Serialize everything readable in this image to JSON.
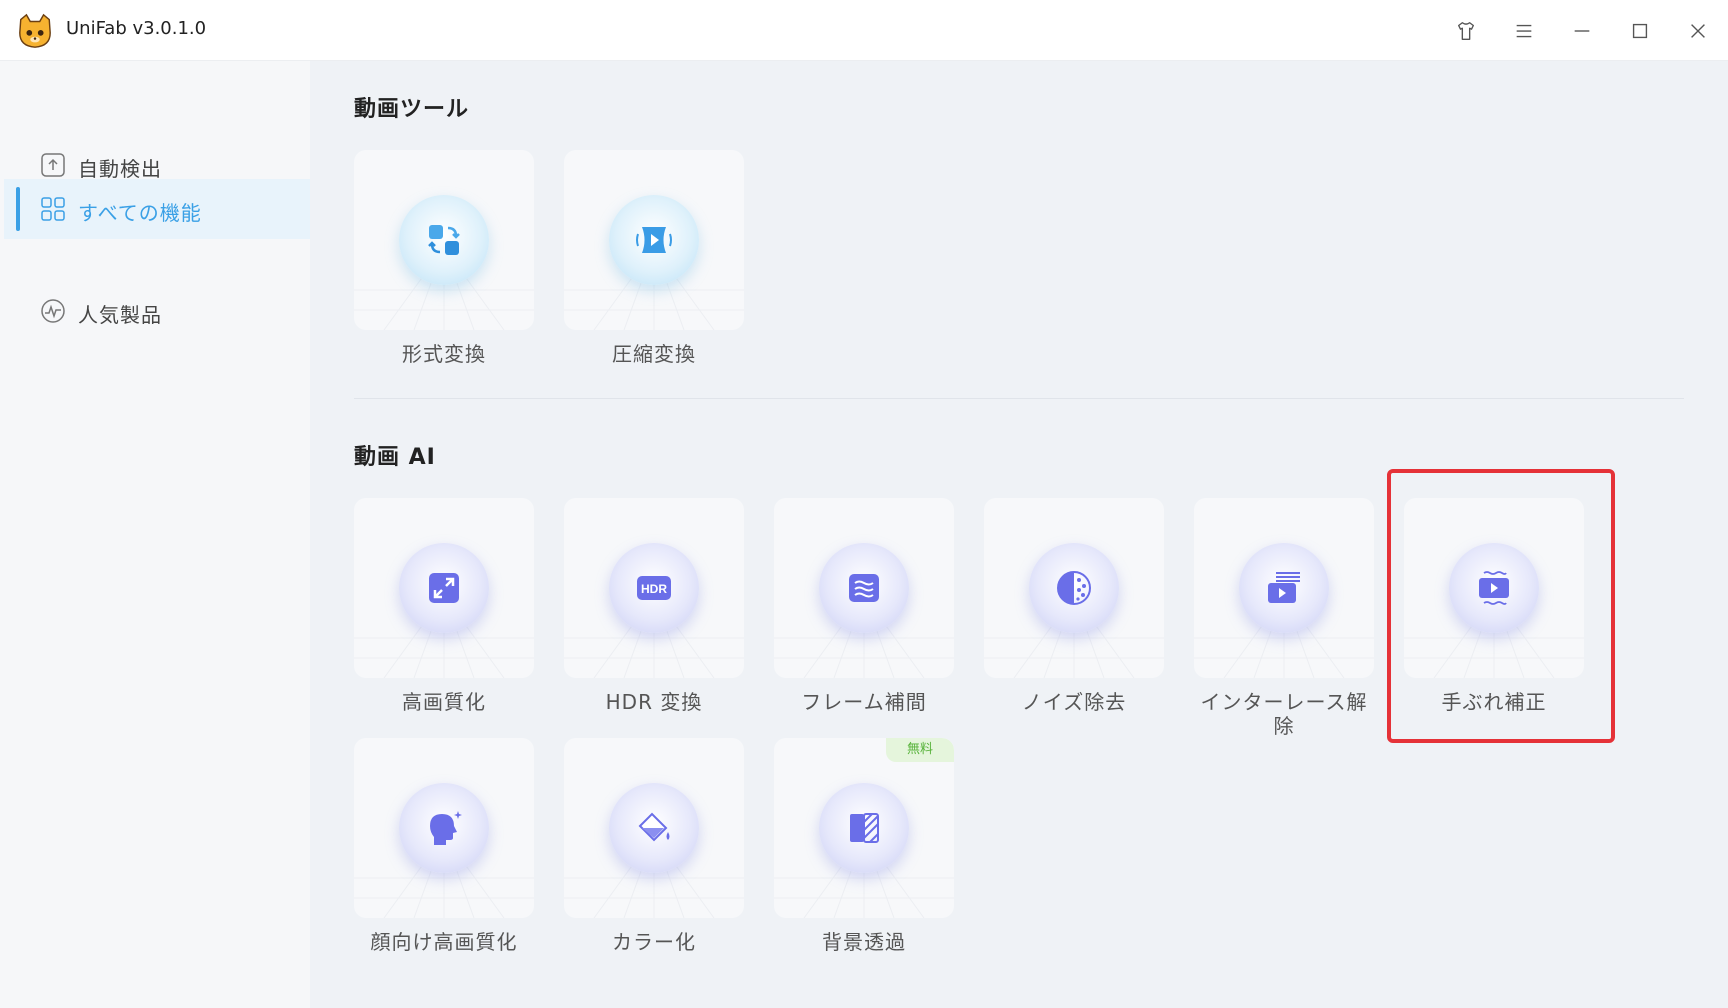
{
  "app": {
    "title": "UniFab v3.0.1.0"
  },
  "titlebar": {
    "icons": [
      "shirt-icon",
      "menu-icon",
      "minimize-icon",
      "maximize-icon",
      "close-icon"
    ]
  },
  "sidebar": {
    "items": [
      {
        "label": "自動検出",
        "icon": "upload-box-icon",
        "active": false
      },
      {
        "label": "すべての機能",
        "icon": "grid-icon",
        "active": true
      },
      {
        "label": "人気製品",
        "icon": "pulse-icon",
        "active": false
      }
    ]
  },
  "sections": [
    {
      "title": "動画ツール",
      "cards": [
        {
          "label": "形式変換",
          "icon": "convert-icon",
          "theme": "blue"
        },
        {
          "label": "圧縮変換",
          "icon": "compress-icon",
          "theme": "blue"
        }
      ]
    },
    {
      "title": "動画 AI",
      "cards": [
        {
          "label": "高画質化",
          "icon": "upscale-icon",
          "theme": "purple"
        },
        {
          "label": "HDR 変換",
          "icon": "hdr-icon",
          "theme": "purple",
          "icon_text": "HDR"
        },
        {
          "label": "フレーム補間",
          "icon": "frame-interpolation-icon",
          "theme": "purple"
        },
        {
          "label": "ノイズ除去",
          "icon": "denoise-icon",
          "theme": "purple"
        },
        {
          "label_line1": "インターレース解",
          "label_line2": "除",
          "icon": "deinterlace-icon",
          "theme": "purple"
        },
        {
          "label": "手ぶれ補正",
          "icon": "stabilize-icon",
          "theme": "purple",
          "highlighted": true
        },
        {
          "label": "顔向け高画質化",
          "icon": "face-enhance-icon",
          "theme": "purple"
        },
        {
          "label": "カラー化",
          "icon": "colorize-icon",
          "theme": "purple"
        },
        {
          "label": "背景透過",
          "icon": "background-remove-icon",
          "theme": "purple",
          "badge": "無料"
        }
      ]
    }
  ],
  "colors": {
    "accent": "#3aa0e6",
    "highlight": "#e53238",
    "badge_text": "#58b33b",
    "badge_bg": "#e5f5dc"
  }
}
